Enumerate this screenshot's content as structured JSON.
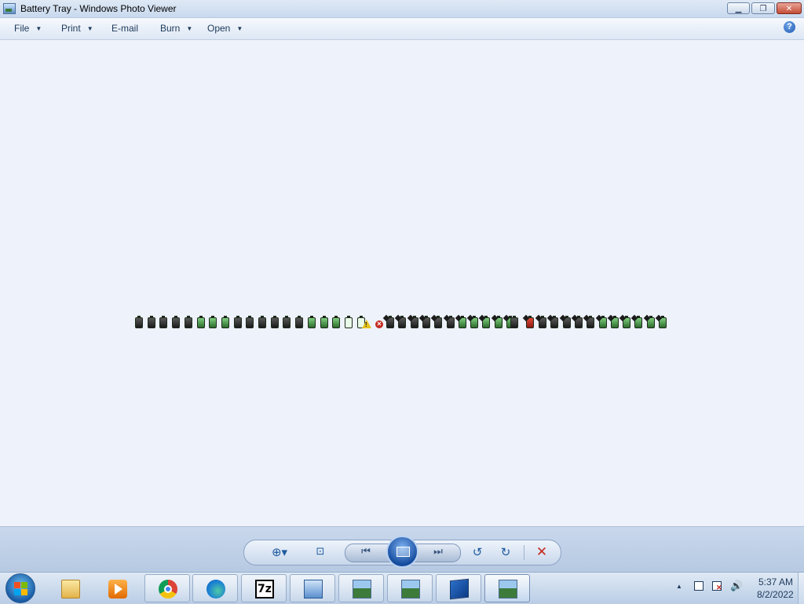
{
  "window": {
    "title": "Battery Tray - Windows Photo Viewer",
    "minimize_glyph": "▁",
    "maximize_glyph": "❐",
    "close_glyph": "✕"
  },
  "menu": {
    "file": "File",
    "print": "Print",
    "email": "E-mail",
    "burn": "Burn",
    "open": "Open",
    "caret": "▼",
    "help_glyph": "?"
  },
  "image": {
    "description_icons": [
      "battery-icon",
      "warning-icon",
      "error-icon",
      "battery-plug-icon",
      "battery-red-icon"
    ],
    "warning_glyph": "!",
    "error_glyph": "✕"
  },
  "controls": {
    "zoom_glyph": "⊕▾",
    "fit_glyph": "⊡",
    "prev_glyph": "⏮",
    "next_glyph": "⏭",
    "rotate_ccw_glyph": "↺",
    "rotate_cw_glyph": "↻",
    "delete_glyph": "✕"
  },
  "taskbar": {
    "sevenzip_label": "7z",
    "tray_arrow": "▲",
    "volume_glyph": "🔊",
    "time": "5:37 AM",
    "date": "8/2/2022"
  }
}
